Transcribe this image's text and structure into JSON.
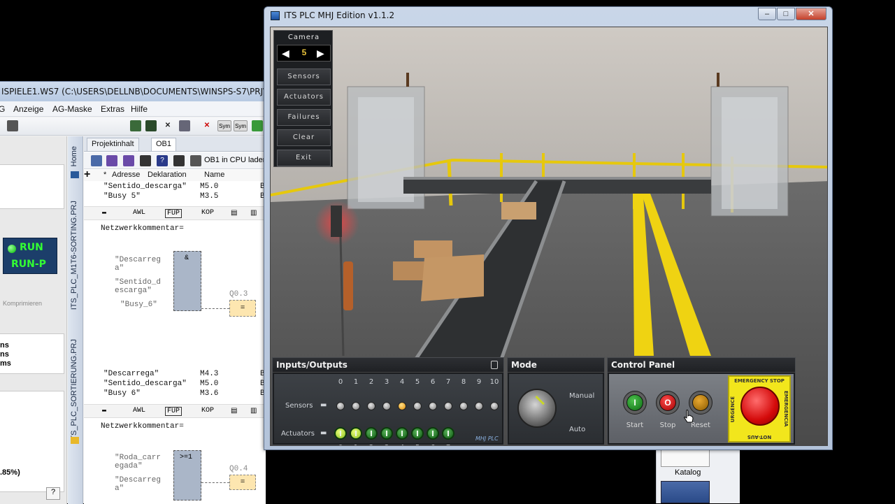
{
  "bg_app": {
    "title": "ISPIELE1.WS7 (C:\\USERS\\DELLNB\\DOCUMENTS\\WINSPS-S7\\PRJ\\BEISPI",
    "menu": [
      "G",
      "Anzeige",
      "AG-Maske",
      "Extras",
      "Hilfe"
    ],
    "toolbar_sym1": "Sym",
    "toolbar_sym2": "Sym",
    "left_panel": {
      "run": "RUN",
      "run_p": "RUN-P",
      "komprimieren": "Komprimieren",
      "lines": [
        "ns",
        "ns",
        "ms"
      ],
      "percent": ".85%)",
      "help": "?"
    },
    "vtabs": {
      "home": "Home",
      "prj1": "ITS_PLC_M1T6-SORTING.PRJ",
      "prj2": "ITS_PLC_SORTIERUNG.PRJ"
    },
    "editor": {
      "tab1": "Projektinhalt",
      "tab2": "OB1",
      "load_cpu": "OB1 in CPU laden",
      "col_adresse": "Adresse",
      "col_deklaration": "Deklaration",
      "col_name": "Name",
      "sym_top": [
        {
          "name": "\"Sentido_descarga\"",
          "addr": "M5.0",
          "tail": "B"
        },
        {
          "name": "\"Busy 5\"",
          "addr": "M3.5",
          "tail": "B"
        }
      ],
      "net1": {
        "awl": "AWL",
        "fup": "FUP",
        "kop": "KOP",
        "comment": "Netzwerkkommentar="
      },
      "fbd1": {
        "in1": "\"Descarreg‑a\"",
        "in1a": "\"Descarreg",
        "in1b": "a\"",
        "in2a": "\"Sentido_d",
        "in2b": "escarga\"",
        "in3": "\"Busy_6\"",
        "gate": "&",
        "out_addr": "Q0.3",
        "coil": "="
      },
      "sym_mid": [
        {
          "name": "\"Descarrega\"",
          "addr": "M4.3",
          "tail": "B"
        },
        {
          "name": "\"Sentido_descarga\"",
          "addr": "M5.0",
          "tail": "B"
        },
        {
          "name": "\"Busy 6\"",
          "addr": "M3.6",
          "tail": "B"
        }
      ],
      "net2": {
        "awl": "AWL",
        "fup": "FUP",
        "kop": "KOP",
        "comment": "Netzwerkkommentar="
      },
      "fbd2": {
        "in1a": "\"Roda_carr",
        "in1b": "egada\"",
        "in2": "\"Descarreg",
        "in2b": "a\"",
        "gate": ">=1",
        "out_addr": "Q0.4",
        "coil": "="
      }
    },
    "katalog": "Katalog"
  },
  "its": {
    "title": "ITS PLC MHJ Edition v1.1.2",
    "window_buttons": {
      "min": "–",
      "max": "□",
      "close": "✕"
    },
    "camera": {
      "label": "Camera",
      "value": "5",
      "prev": "◀",
      "next": "▶"
    },
    "menu": [
      "Sensors",
      "Actuators",
      "Failures",
      "Clear",
      "Exit"
    ],
    "io": {
      "title": "Inputs/Outputs",
      "sensors_label": "Sensors",
      "actuators_label": "Actuators",
      "sensor_numbers": [
        "0",
        "1",
        "2",
        "3",
        "4",
        "5",
        "6",
        "7",
        "8",
        "9",
        "10"
      ],
      "sensor_states": [
        false,
        false,
        false,
        false,
        true,
        false,
        false,
        false,
        false,
        false,
        false
      ],
      "actuator_numbers": [
        "0",
        "1",
        "2",
        "3",
        "4",
        "5",
        "6",
        "7"
      ],
      "actuator_states": [
        true,
        true,
        false,
        false,
        false,
        false,
        false,
        false
      ],
      "brand": "MHJ PLC"
    },
    "mode": {
      "title": "Mode",
      "manual": "Manual",
      "auto": "Auto"
    },
    "control": {
      "title": "Control Panel",
      "start": "Start",
      "stop": "Stop",
      "reset": "Reset",
      "start_glyph": "I",
      "stop_glyph": "O",
      "estop_top": "EMERGENCY STOP",
      "estop_bottom": "NOT-AUS",
      "estop_left": "URGENCE",
      "estop_right": "EMERGENCIA"
    }
  }
}
